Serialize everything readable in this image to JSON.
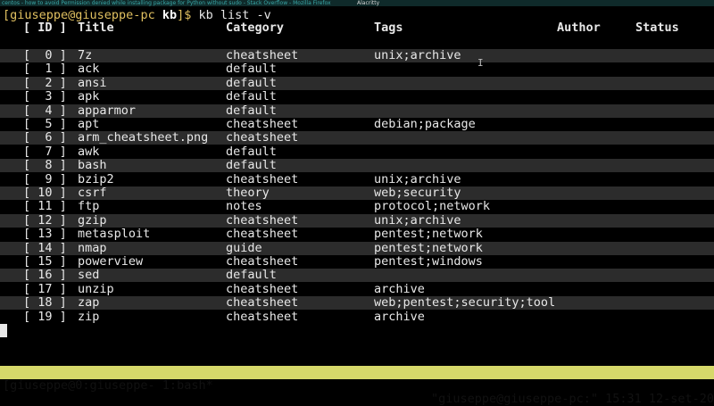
{
  "browser_tabs": {
    "tab1": "centos - how to avoid Permission denied while installing package for Python without sudo - Stack Overflow - Mozilla Firefox",
    "tab2": "Alacritty"
  },
  "prompt": {
    "open_bracket": "[",
    "user_host": "giuseppe@giuseppe-pc",
    "directory": "kb",
    "close_bracket": "]$",
    "command": "kb list -v"
  },
  "table": {
    "headers": {
      "id": "[ ID ]",
      "title": "Title",
      "category": "Category",
      "tags": "Tags",
      "author": "Author",
      "status": "Status"
    },
    "rows": [
      {
        "id": "[  0 ]",
        "title": "7z",
        "category": "cheatsheet",
        "tags": "unix;archive"
      },
      {
        "id": "[  1 ]",
        "title": "ack",
        "category": "default",
        "tags": ""
      },
      {
        "id": "[  2 ]",
        "title": "ansi",
        "category": "default",
        "tags": ""
      },
      {
        "id": "[  3 ]",
        "title": "apk",
        "category": "default",
        "tags": ""
      },
      {
        "id": "[  4 ]",
        "title": "apparmor",
        "category": "default",
        "tags": ""
      },
      {
        "id": "[  5 ]",
        "title": "apt",
        "category": "cheatsheet",
        "tags": "debian;package"
      },
      {
        "id": "[  6 ]",
        "title": "arm_cheatsheet.png",
        "category": "cheatsheet",
        "tags": ""
      },
      {
        "id": "[  7 ]",
        "title": "awk",
        "category": "default",
        "tags": ""
      },
      {
        "id": "[  8 ]",
        "title": "bash",
        "category": "default",
        "tags": ""
      },
      {
        "id": "[  9 ]",
        "title": "bzip2",
        "category": "cheatsheet",
        "tags": "unix;archive"
      },
      {
        "id": "[ 10 ]",
        "title": "csrf",
        "category": "theory",
        "tags": "web;security"
      },
      {
        "id": "[ 11 ]",
        "title": "ftp",
        "category": "notes",
        "tags": "protocol;network"
      },
      {
        "id": "[ 12 ]",
        "title": "gzip",
        "category": "cheatsheet",
        "tags": "unix;archive"
      },
      {
        "id": "[ 13 ]",
        "title": "metasploit",
        "category": "cheatsheet",
        "tags": "pentest;network"
      },
      {
        "id": "[ 14 ]",
        "title": "nmap",
        "category": "guide",
        "tags": "pentest;network"
      },
      {
        "id": "[ 15 ]",
        "title": "powerview",
        "category": "cheatsheet",
        "tags": "pentest;windows"
      },
      {
        "id": "[ 16 ]",
        "title": "sed",
        "category": "default",
        "tags": ""
      },
      {
        "id": "[ 17 ]",
        "title": "unzip",
        "category": "cheatsheet",
        "tags": "archive"
      },
      {
        "id": "[ 18 ]",
        "title": "zap",
        "category": "cheatsheet",
        "tags": "web;pentest;security;tool"
      },
      {
        "id": "[ 19 ]",
        "title": "zip",
        "category": "cheatsheet",
        "tags": "archive"
      }
    ]
  },
  "statusbar": {
    "left": "[giuseppe@0:giuseppe- 1:bash*",
    "right": "\"giuseppe@giuseppe-pc:\" 15:31 12-set-20"
  }
}
